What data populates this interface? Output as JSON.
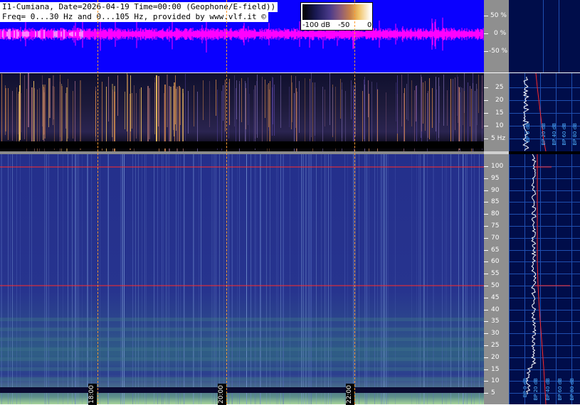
{
  "header": {
    "line1": "I1-Cumiana, Date=2026-04-19 Time=00:00 (Geophone/E-field))",
    "line2": "Freq= 0...30 Hz and 0...105 Hz, provided by www.vlf.it ©"
  },
  "colorbar": {
    "labels": [
      "-100 dB",
      "-50",
      "0"
    ]
  },
  "waveform_axis": {
    "ticks": [
      "50 %",
      "0 %",
      "-50 %"
    ]
  },
  "top_axis": {
    "ticks": [
      "25",
      "20",
      "15",
      "10",
      "5 Hz"
    ]
  },
  "main_axis": {
    "ticks": [
      "100",
      "95",
      "90",
      "85",
      "80",
      "75",
      "70",
      "65",
      "60",
      "55",
      "50",
      "45",
      "40",
      "35",
      "30",
      "25",
      "20",
      "15",
      "10",
      "5"
    ]
  },
  "time_labels": [
    "18:00",
    "20:00",
    "22:00"
  ],
  "profile_top_labels": [
    "BP 0 dB",
    "BP 20 dB",
    "BP 40 dB",
    "BP 60 dB",
    "BP 80 dB"
  ],
  "profile_main_labels": [
    "BP 0 dB",
    "BP 20 dB",
    "BP 40 dB",
    "BP 60 dB",
    "BP 80 dB"
  ],
  "colors": {
    "waveform_bg": "#0a00ff",
    "waveform_trace": "#ff00ff",
    "marker_line": "#ff9a30",
    "hum_line": "#ff2a2a",
    "profile_bg": "#000d4a"
  },
  "icons": {
    "copyright": "copyright-icon"
  }
}
